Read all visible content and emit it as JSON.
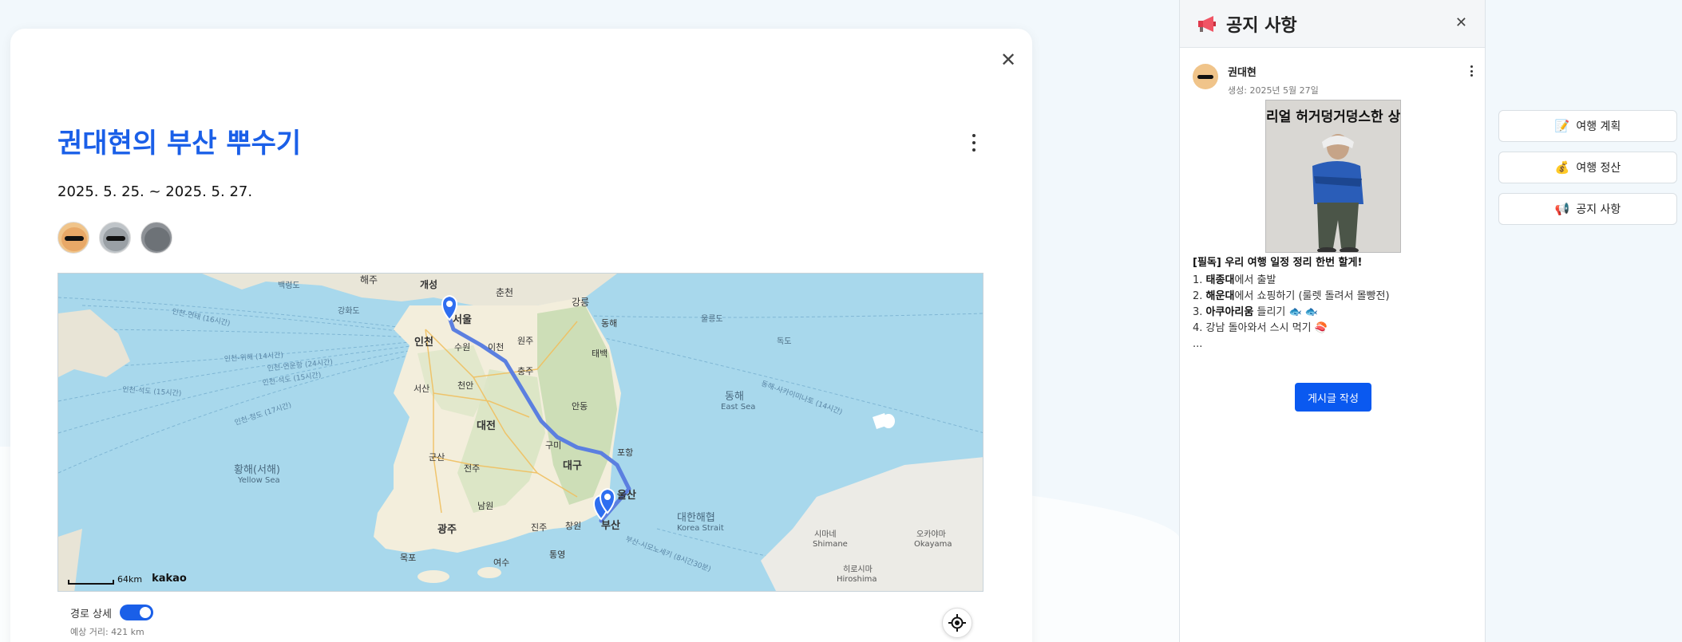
{
  "card": {
    "close_glyph": "✕",
    "title": "권대현의 부산 뿌수기",
    "dates": "2025. 5. 25. ~ 2025. 5. 27.",
    "members": [
      "member-1",
      "member-2",
      "member-3"
    ]
  },
  "map": {
    "scale_text": "64km",
    "brand": "kakao",
    "labels": {
      "haeju": "해주",
      "kaesong": "개성",
      "chuncheon": "춘천",
      "gangneung": "강릉",
      "seoul": "서울",
      "incheon": "인천",
      "suwon": "수원",
      "icheon": "이천",
      "wonju": "원주",
      "donghae": "동해",
      "taebaek": "태백",
      "chungju": "충주",
      "seosan": "서산",
      "cheonan": "천안",
      "andong": "안동",
      "daejeon": "대전",
      "gumi": "구미",
      "pohang": "포항",
      "gunsan": "군산",
      "jeonju": "전주",
      "daegu": "대구",
      "ulsan": "울산",
      "namwon": "남원",
      "gwangju": "광주",
      "jinju": "진주",
      "changwon": "창원",
      "busan": "부산",
      "mokpo": "목포",
      "yeosu": "여수",
      "tongyeong": "통영",
      "yellow_sea_ko": "황해(서해)",
      "yellow_sea_en": "Yellow Sea",
      "east_sea_ko": "동해",
      "east_sea_en": "East Sea",
      "strait_ko": "대한해협",
      "strait_en": "Korea Strait",
      "ulleungdo": "울릉도",
      "dokdo": "독도",
      "baengnyeongdo": "백령도",
      "ganghwa": "강화도",
      "shimane_ko": "시마네",
      "shimane_en": "Shimane",
      "okayama_ko": "오카야마",
      "okayama_en": "Okayama",
      "hiroshima_ko": "히로시마",
      "hiroshima_en": "Hiroshima",
      "ferry1": "인천-위해 (14시간)",
      "ferry2": "인천-연운항 (24시간)",
      "ferry3": "인천-석도 (15시간)",
      "ferry4": "인천-석도 (15시간)",
      "ferry5": "인천-청도 (17시간)",
      "ferry6": "인천-연태 (16시간)",
      "ferry7": "동해-사카이미나토 (14시간)",
      "ferry8": "부산-시모노세키 (8시간30분)"
    }
  },
  "route": {
    "toggle_label": "경로 상세",
    "toggle_on": true,
    "distance": "예상 거리: 421 km"
  },
  "notice": {
    "title": "공지 사항",
    "close_glyph": "✕",
    "author": "권대현",
    "created": "생성: 2025년 5월 27일",
    "meme_caption": "리얼 허거덩거덩스한 상황",
    "post_title": "[필독] 우리 여행 일정 정리 한번 할게!",
    "items": [
      {
        "num": "1. ",
        "bold": "태종대",
        "rest": "에서 출발"
      },
      {
        "num": "2. ",
        "bold": "해운대",
        "rest": "에서 쇼핑하기 (룰렛 돌려서 몰빵전)"
      },
      {
        "num": "3. ",
        "bold": "아쿠아리움",
        "rest": " 들리기 🐟 🐟"
      },
      {
        "num": "4. ",
        "bold": "",
        "rest": "강남 돌아와서 스시 먹기 🍣"
      }
    ],
    "ellipsis": "...",
    "write_button": "게시글 작성"
  },
  "menu": {
    "items": [
      {
        "icon": "📝",
        "label": "여행 계획"
      },
      {
        "icon": "💰",
        "label": "여행 정산"
      },
      {
        "icon": "📢",
        "label": "공지 사항"
      }
    ]
  },
  "colors": {
    "brand_blue": "#1a5fe8",
    "button_blue": "#0a59f0",
    "route_line": "#5b7fe0"
  }
}
